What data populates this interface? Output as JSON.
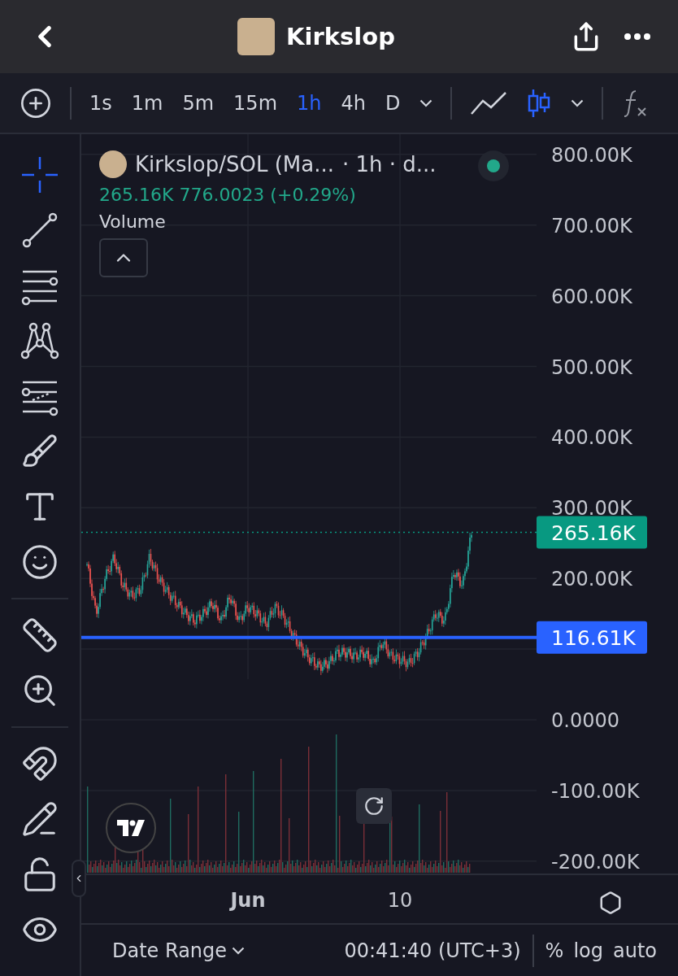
{
  "header": {
    "title": "Kirkslop"
  },
  "toolbar": {
    "intervals": [
      {
        "label": "1s",
        "selected": false
      },
      {
        "label": "1m",
        "selected": false
      },
      {
        "label": "5m",
        "selected": false
      },
      {
        "label": "15m",
        "selected": false
      },
      {
        "label": "1h",
        "selected": true
      },
      {
        "label": "4h",
        "selected": false
      },
      {
        "label": "D",
        "selected": false
      }
    ],
    "chart_types": [
      {
        "kind": "line",
        "selected": false
      },
      {
        "kind": "candles",
        "selected": true
      }
    ]
  },
  "tool_groups": [
    {
      "tools": [
        {
          "kind": "crosshair",
          "selected": true
        },
        {
          "kind": "trend_line",
          "selected": false
        },
        {
          "kind": "fib",
          "selected": false
        },
        {
          "kind": "pattern",
          "selected": false
        },
        {
          "kind": "projection",
          "selected": false
        },
        {
          "kind": "brush",
          "selected": false
        },
        {
          "kind": "text",
          "selected": false
        },
        {
          "kind": "emoji",
          "selected": false
        }
      ]
    },
    {
      "tools": [
        {
          "kind": "ruler",
          "selected": false
        },
        {
          "kind": "zoom",
          "selected": false
        }
      ]
    },
    {
      "tools": [
        {
          "kind": "magnet",
          "selected": false
        },
        {
          "kind": "pencil_lock",
          "selected": false
        },
        {
          "kind": "lock",
          "selected": false
        },
        {
          "kind": "eye",
          "selected": false
        }
      ]
    }
  ],
  "legend": {
    "symbol": "Kirkslop/SOL (Ma...",
    "meta": "· 1h · d...",
    "values": "265.16K 776.0023 (+0.29%)",
    "study": "Volume"
  },
  "price_axis": [
    "800.00K",
    "700.00K",
    "600.00K",
    "500.00K",
    "400.00K",
    "300.00K",
    "200.00K",
    "0.0000",
    "-100.00K",
    "-200.00K"
  ],
  "time_axis": [
    "Jun",
    "10"
  ],
  "price_badges": [
    {
      "kind": "last_price",
      "label": "265.16K"
    },
    {
      "kind": "horizontal_line",
      "label": "116.61K"
    }
  ],
  "bottom_bar": {
    "date_range": "Date Range",
    "time": "00:41:40 (UTC+3)",
    "options": [
      "%",
      "log",
      "auto"
    ]
  }
}
